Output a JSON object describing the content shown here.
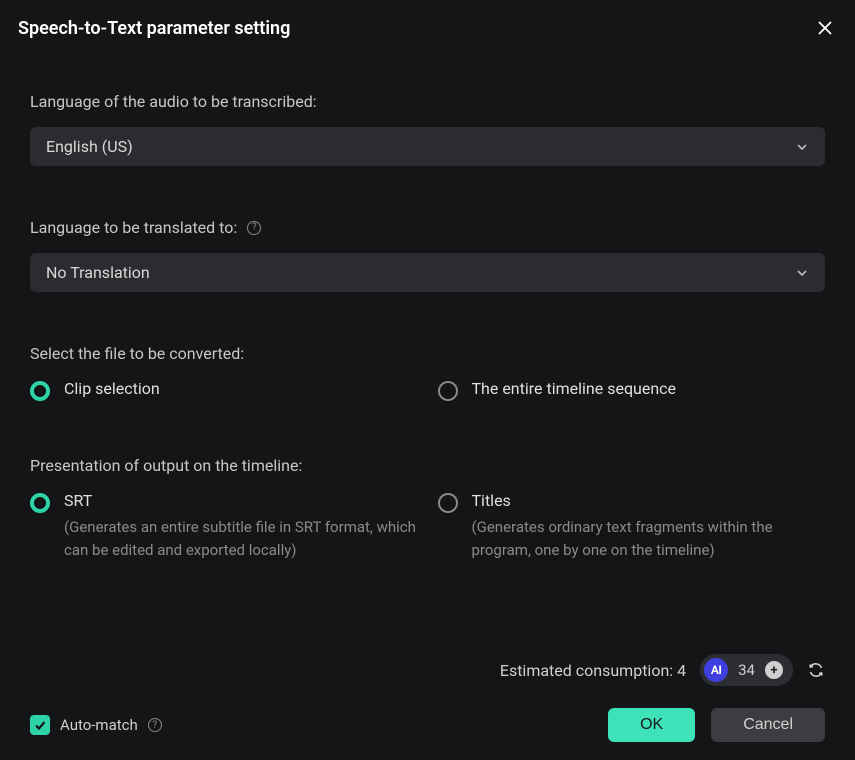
{
  "header": {
    "title": "Speech-to-Text parameter setting"
  },
  "audioLanguage": {
    "label": "Language of the audio to be transcribed:",
    "value": "English (US)"
  },
  "translateLanguage": {
    "label": "Language to be translated to:",
    "value": "No Translation"
  },
  "fileSelect": {
    "label": "Select the file to be converted:",
    "option1": "Clip selection",
    "option2": "The entire timeline sequence"
  },
  "presentation": {
    "label": "Presentation of output on the timeline:",
    "option1": {
      "title": "SRT",
      "desc": "(Generates an entire subtitle file in SRT format, which can be edited and exported locally)"
    },
    "option2": {
      "title": "Titles",
      "desc": "(Generates ordinary text fragments within the program, one by one on the timeline)"
    }
  },
  "footer": {
    "consumption_label": "Estimated consumption:",
    "consumption_value": "4",
    "ai_badge": "AI",
    "ai_credits": "34",
    "automatch": "Auto-match",
    "ok": "OK",
    "cancel": "Cancel"
  }
}
